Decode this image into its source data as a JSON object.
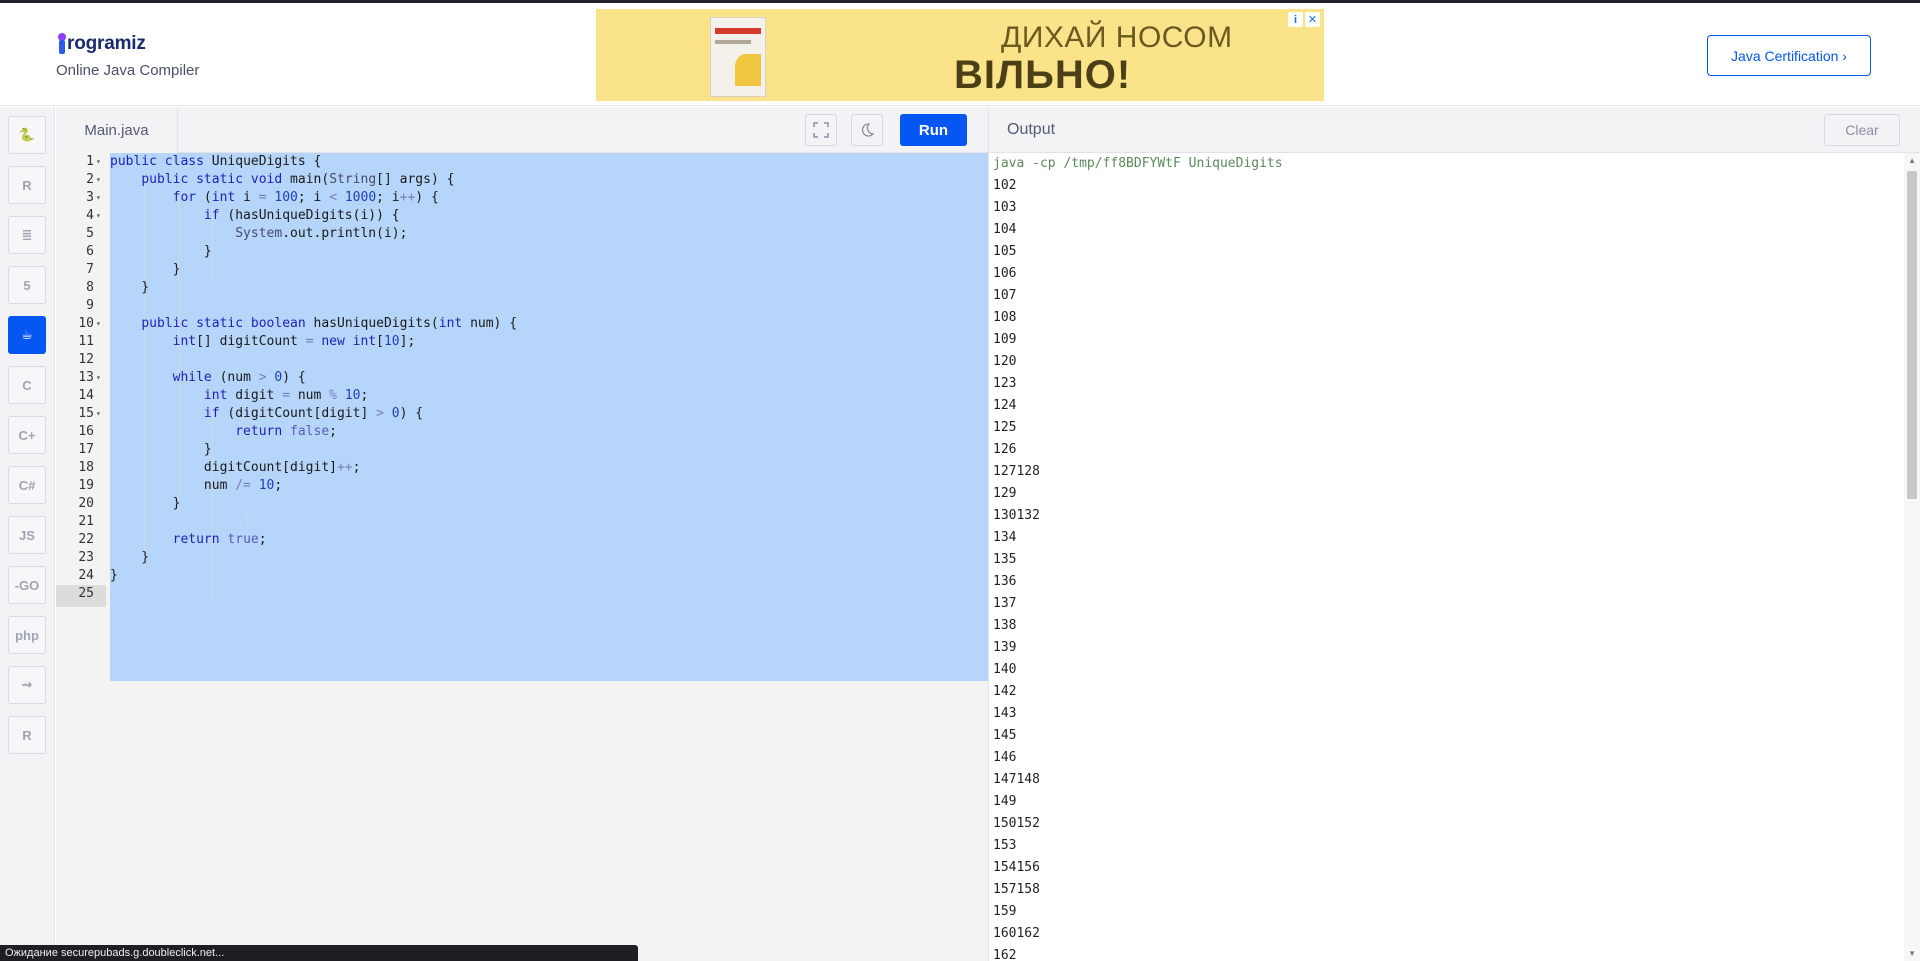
{
  "header": {
    "logo_text": "rogramiz",
    "logo_initial": "P",
    "subtitle": "Online Java Compiler",
    "certification_button": "Java Certification ›"
  },
  "ad": {
    "line1": "ДИХАЙ НОСОМ",
    "line2": "ВІЛЬНО!"
  },
  "languages": [
    {
      "name": "python",
      "label": "🐍"
    },
    {
      "name": "r",
      "label": "R"
    },
    {
      "name": "sql",
      "label": "≣"
    },
    {
      "name": "html",
      "label": "5"
    },
    {
      "name": "java",
      "label": "☕",
      "active": true
    },
    {
      "name": "c",
      "label": "C"
    },
    {
      "name": "cpp",
      "label": "C+"
    },
    {
      "name": "csharp",
      "label": "C#"
    },
    {
      "name": "js",
      "label": "JS"
    },
    {
      "name": "go",
      "label": "-GO"
    },
    {
      "name": "php",
      "label": "php"
    },
    {
      "name": "swift",
      "label": "⇝"
    },
    {
      "name": "rust",
      "label": "R"
    }
  ],
  "editor": {
    "tab_name": "Main.java",
    "run_label": "Run",
    "line_numbers": [
      "1",
      "2",
      "3",
      "4",
      "5",
      "6",
      "7",
      "8",
      "9",
      "10",
      "11",
      "12",
      "13",
      "14",
      "15",
      "16",
      "17",
      "18",
      "19",
      "20",
      "21",
      "22",
      "23",
      "24",
      "25"
    ],
    "code_lines": [
      "public class UniqueDigits {",
      "    public static void main(String[] args) {",
      "        for (int i = 100; i < 1000; i++) {",
      "            if (hasUniqueDigits(i)) {",
      "                System.out.println(i);",
      "            }",
      "        }",
      "    }",
      "",
      "    public static boolean hasUniqueDigits(int num) {",
      "        int[] digitCount = new int[10];",
      "",
      "        while (num > 0) {",
      "            int digit = num % 10;",
      "            if (digitCount[digit] > 0) {",
      "                return false;",
      "            }",
      "            digitCount[digit]++;",
      "            num /= 10;",
      "        }",
      "",
      "        return true;",
      "    }",
      "}",
      ""
    ]
  },
  "output": {
    "title": "Output",
    "clear_label": "Clear",
    "command": "java -cp /tmp/ff8BDFYWtF UniqueDigits",
    "lines": [
      "102",
      "103",
      "104",
      "105",
      "106",
      "107",
      "108",
      "109",
      "120",
      "123",
      "124",
      "125",
      "126",
      "127128",
      "129",
      "130132",
      "134",
      "135",
      "136",
      "137",
      "138",
      "139",
      "140",
      "142",
      "143",
      "145",
      "146",
      "147148",
      "149",
      "150152",
      "153",
      "154156",
      "157158",
      "159",
      "160162",
      "162"
    ]
  },
  "status_bar": "Ожидание securepubads.g.doubleclick.net..."
}
